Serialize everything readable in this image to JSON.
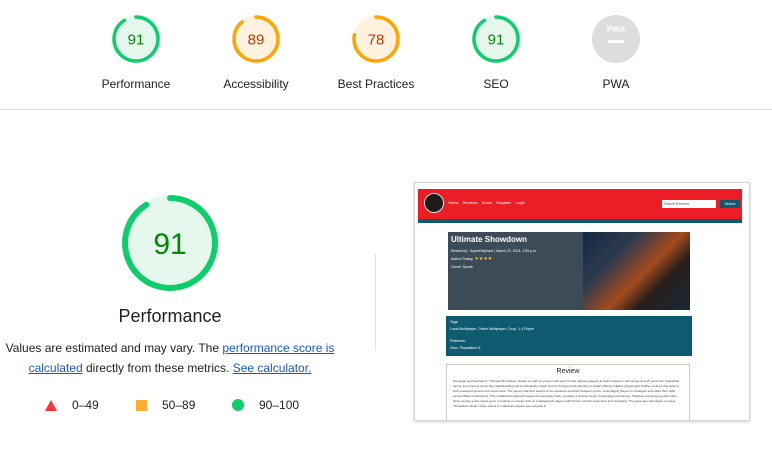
{
  "categories": [
    {
      "name": "Performance",
      "score": "91",
      "fraction": 0.91,
      "status": "pass"
    },
    {
      "name": "Accessibility",
      "score": "89",
      "fraction": 0.89,
      "status": "average"
    },
    {
      "name": "Best Practices",
      "score": "78",
      "fraction": 0.78,
      "status": "average"
    },
    {
      "name": "SEO",
      "score": "91",
      "fraction": 0.91,
      "status": "pass"
    },
    {
      "name": "PWA",
      "score": "PWA",
      "status": "na"
    }
  ],
  "detail": {
    "score": "91",
    "fraction": 0.91,
    "title": "Performance",
    "desc_1": "Values are estimated and may vary. The ",
    "link_1": "performance score is calculated",
    "desc_2": " directly from these metrics. ",
    "link_2": "See calculator."
  },
  "legend": [
    {
      "range": "0–49",
      "color": "#ff3333"
    },
    {
      "range": "50–89",
      "color": "#ffaa33"
    },
    {
      "range": "90–100",
      "color": "#0cce6b"
    }
  ],
  "colors": {
    "pass": "#0cce6b",
    "pass_bg": "#e6f7ee",
    "pass_text": "#008800",
    "average": "#ffa400",
    "average_bg": "#fff3e0",
    "average_text": "#c33300",
    "na": "#dddddd"
  },
  "screenshot": {
    "nav_links": [
      "Home",
      "Reviews",
      "About",
      "Register",
      "Login"
    ],
    "search_placeholder": "Search Reviews",
    "search_button": "Search",
    "game_title": "Ultimate Showdown",
    "review_by": "Review by : SuperElephant | March 22, 2024, 2:55 p.m.",
    "rating_label": "Author Rating:",
    "stars": "★★★★",
    "genre": "Genre: Sports",
    "tags_label": "Tags:",
    "tags": "Local Multiplayer, Online Multiplayer, Coop, 1-4 Player",
    "platforms_label": "Platforms:",
    "platforms": "Xbox, Playstation 5,",
    "review_heading": "Review",
    "review_body": "Gameplay and Mechanics \"Ultimate Showdown\" stands out with its unique multi-sport format, allowing players to switch between various sports such as soccer, basketball, tennis, and extreme sports like skateboarding and snowboarding. Each sport is designed with attention to detail, offering realistic physics and intuitive controls that cater to both seasoned gamers and newcomers. The game's standout feature is the seamless transition between sports, encouraging players to strategize and utilize their skills across different disciplines. This multifaceted approach keeps the gameplay fresh, providing a diverse range of gameplay experiences. Whether executing a perfect slam dunk, scoring a last-minute goal, or landing a complex trick on a skateboard, players will find the controls responsive and rewarding. The game also introduces a unique \"Showdown Mode\" where teams or individuals players can compete in"
  }
}
